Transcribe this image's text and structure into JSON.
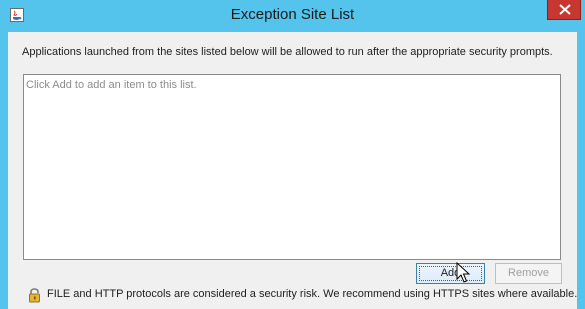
{
  "window": {
    "title": "Exception Site List"
  },
  "description": "Applications launched from the sites listed below will be allowed to run after the appropriate security prompts.",
  "site_list": {
    "placeholder": "Click Add to add an item to this list.",
    "items": []
  },
  "buttons": {
    "add_label": "Add",
    "remove_label": "Remove"
  },
  "warning": {
    "icon": "lock-icon",
    "text": "FILE and HTTP protocols are considered a security risk.  We recommend using HTTPS sites where available."
  },
  "colors": {
    "titlebar": "#54c4ec",
    "close_button": "#c7372f",
    "client_background": "#f0f0f0"
  }
}
